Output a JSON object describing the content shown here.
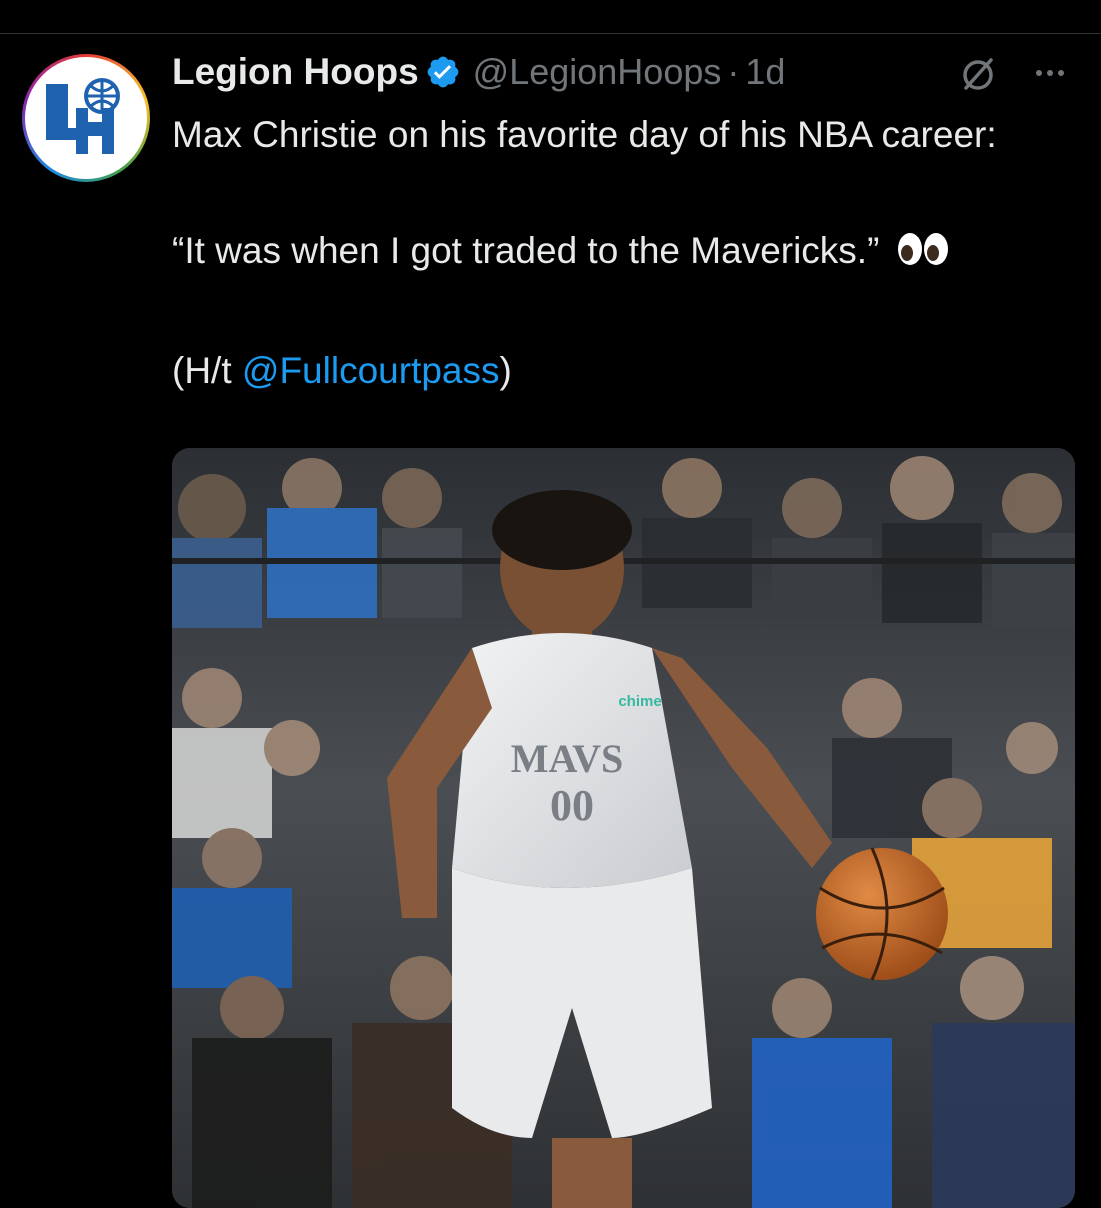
{
  "tweet": {
    "author": {
      "display_name": "Legion Hoops",
      "handle": "@LegionHoops",
      "avatar_icon": "legion-hoops-logo",
      "avatar_letters": "LH",
      "verified": true
    },
    "separator": "·",
    "time": "1d",
    "text": {
      "line1": "Max Christie on his favorite day of his NBA career:",
      "quote": "“It was when I got traded to the Mavericks.”",
      "quote_emoji": "eyes-emoji",
      "credit_prefix": "(H/t ",
      "credit_mention": "@Fullcourtpass",
      "credit_suffix": ")"
    },
    "actions": {
      "grok_icon": "grok-icon",
      "more_icon": "more-dots-icon"
    },
    "media": {
      "type": "photo",
      "jersey_wordmark": "MAVS",
      "jersey_number": "00",
      "jersey_sponsor": "chime"
    }
  },
  "colors": {
    "background": "#000000",
    "text": "#e7e9ea",
    "secondary_text": "#71767b",
    "link": "#1d9bf0",
    "verified": "#1d9bf0"
  }
}
